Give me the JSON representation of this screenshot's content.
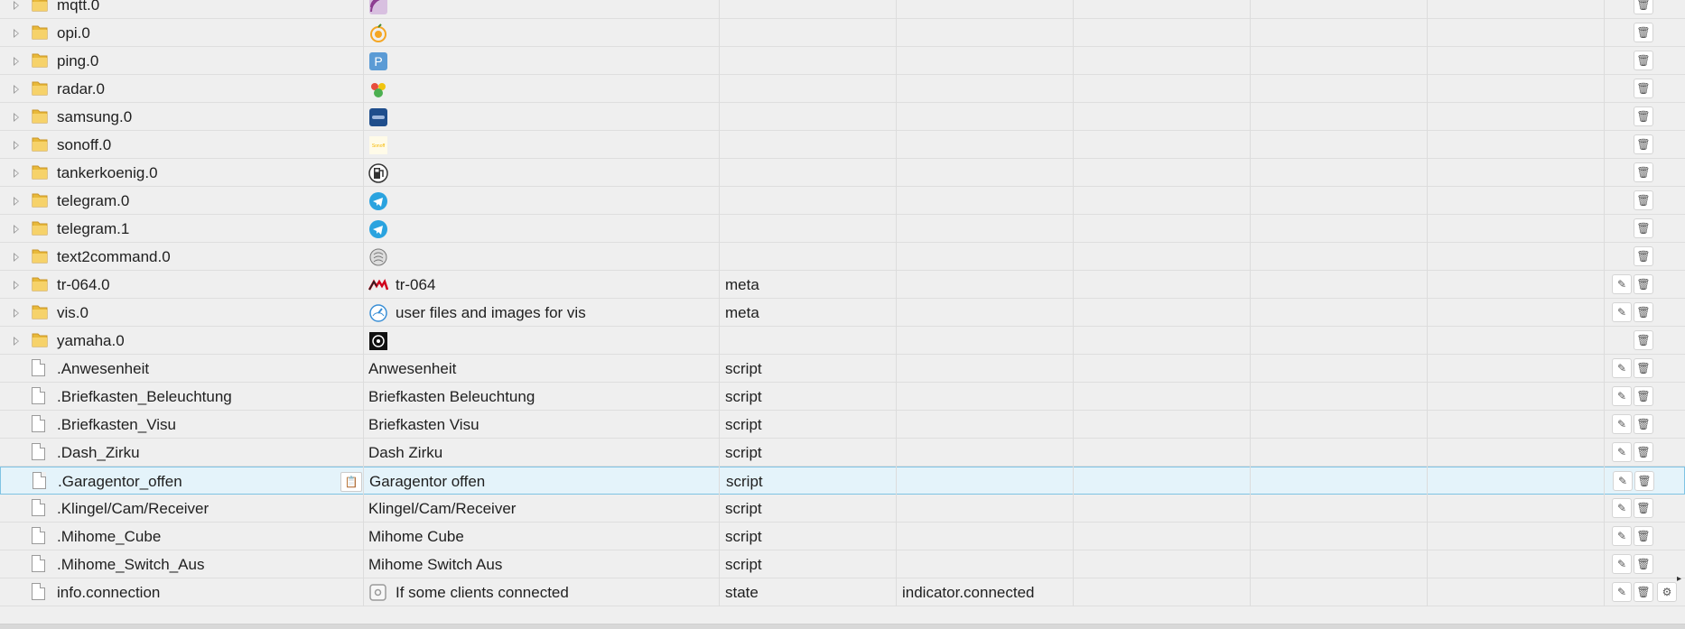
{
  "rows": [
    {
      "type": "folder",
      "name": "mqtt.0",
      "icon": "mqtt-icon",
      "iconColor": "#8b3a8f",
      "desc": "",
      "role": "",
      "subrole": "",
      "edit": false
    },
    {
      "type": "folder",
      "name": "opi.0",
      "icon": "orange-pi-icon",
      "iconColor": "#f5a623",
      "desc": "",
      "role": "",
      "subrole": "",
      "edit": false
    },
    {
      "type": "folder",
      "name": "ping.0",
      "icon": "ping-p-icon",
      "iconColor": "#5b9bd5",
      "desc": "",
      "role": "",
      "subrole": "",
      "edit": false
    },
    {
      "type": "folder",
      "name": "radar.0",
      "icon": "radar-icon",
      "iconColor": "#4caf50",
      "desc": "",
      "role": "",
      "subrole": "",
      "edit": false
    },
    {
      "type": "folder",
      "name": "samsung.0",
      "icon": "samsung-icon",
      "iconColor": "#1f4e8c",
      "desc": "",
      "role": "",
      "subrole": "",
      "edit": false
    },
    {
      "type": "folder",
      "name": "sonoff.0",
      "icon": "sonoff-icon",
      "iconColor": "#f5b800",
      "desc": "",
      "role": "",
      "subrole": "",
      "edit": false
    },
    {
      "type": "folder",
      "name": "tankerkoenig.0",
      "icon": "fuel-pump-icon",
      "iconColor": "#333333",
      "desc": "",
      "role": "",
      "subrole": "",
      "edit": false
    },
    {
      "type": "folder",
      "name": "telegram.0",
      "icon": "telegram-icon",
      "iconColor": "#2aa3df",
      "desc": "",
      "role": "",
      "subrole": "",
      "edit": false
    },
    {
      "type": "folder",
      "name": "telegram.1",
      "icon": "telegram-icon",
      "iconColor": "#2aa3df",
      "desc": "",
      "role": "",
      "subrole": "",
      "edit": false
    },
    {
      "type": "folder",
      "name": "text2command.0",
      "icon": "brain-icon",
      "iconColor": "#777777",
      "desc": "",
      "role": "",
      "subrole": "",
      "edit": false
    },
    {
      "type": "folder",
      "name": "tr-064.0",
      "icon": "avm-logo-icon",
      "iconColor": "#d0021b",
      "desc": "tr-064",
      "role": "meta",
      "subrole": "",
      "edit": true
    },
    {
      "type": "folder",
      "name": "vis.0",
      "icon": "speedometer-icon",
      "iconColor": "#3a8fd6",
      "desc": "user files and images for vis",
      "role": "meta",
      "subrole": "",
      "edit": true
    },
    {
      "type": "folder",
      "name": "yamaha.0",
      "icon": "yamaha-icon",
      "iconColor": "#111111",
      "desc": "",
      "role": "",
      "subrole": "",
      "edit": false
    },
    {
      "type": "file",
      "name": ".Anwesenheit",
      "icon": "",
      "iconColor": "",
      "desc": "Anwesenheit",
      "role": "script",
      "subrole": "",
      "edit": true
    },
    {
      "type": "file",
      "name": ".Briefkasten_Beleuchtung",
      "icon": "",
      "iconColor": "",
      "desc": "Briefkasten Beleuchtung",
      "role": "script",
      "subrole": "",
      "edit": true
    },
    {
      "type": "file",
      "name": ".Briefkasten_Visu",
      "icon": "",
      "iconColor": "",
      "desc": "Briefkasten Visu",
      "role": "script",
      "subrole": "",
      "edit": true
    },
    {
      "type": "file",
      "name": ".Dash_Zirku",
      "icon": "",
      "iconColor": "",
      "desc": "Dash Zirku",
      "role": "script",
      "subrole": "",
      "edit": true
    },
    {
      "type": "file",
      "name": ".Garagentor_offen",
      "icon": "",
      "iconColor": "",
      "desc": "Garagentor offen",
      "role": "script",
      "subrole": "",
      "edit": true,
      "selected": true
    },
    {
      "type": "file",
      "name": ".Klingel/Cam/Receiver",
      "icon": "",
      "iconColor": "",
      "desc": "Klingel/Cam/Receiver",
      "role": "script",
      "subrole": "",
      "edit": true
    },
    {
      "type": "file",
      "name": ".Mihome_Cube",
      "icon": "",
      "iconColor": "",
      "desc": "Mihome Cube",
      "role": "script",
      "subrole": "",
      "edit": true
    },
    {
      "type": "file",
      "name": ".Mihome_Switch_Aus",
      "icon": "",
      "iconColor": "",
      "desc": "Mihome Switch Aus",
      "role": "script",
      "subrole": "",
      "edit": true
    },
    {
      "type": "file",
      "name": "info.connection",
      "icon": "state-icon",
      "iconColor": "#9a9a9a",
      "desc": "If some clients connected",
      "role": "state",
      "subrole": "indicator.connected",
      "edit": true,
      "gear": true
    }
  ]
}
